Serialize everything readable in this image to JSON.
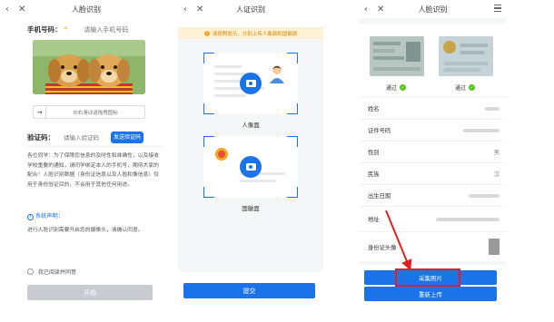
{
  "panel1": {
    "nav": {
      "back": "‹",
      "close": "✕",
      "title": "人脸识别"
    },
    "phone": {
      "label": "手机号码：",
      "required": "*",
      "placeholder": "请输入手机号码"
    },
    "doc_button": {
      "label": "向右滑动请拖拽图标"
    },
    "code": {
      "label": "验证码：",
      "placeholder": "请输入验证码",
      "send_button": "发送验证码"
    },
    "notice": "各位同学：为了保障您信息的及时性和准确性，以及接收学校重要的通知，请同学绑定本人的手机号，期待大家的配合！人脸识别数据（身份证信息以及人脸和像信息）仅用于身份验证目的，不会用于其他任何用途。",
    "declaration": {
      "title": "系统声明：",
      "text": "进行人脸识别需要开启您的摄像头，请确认同意。"
    },
    "agree": {
      "label": "我已阅读并同意"
    },
    "start_button": {
      "label": "开始"
    }
  },
  "panel2": {
    "nav": {
      "back": "‹",
      "close": "✕",
      "title": "人证识别"
    },
    "tip": {
      "icon": "!",
      "text": "请按照提示，分别上传人像面和国徽面"
    },
    "portrait_label": "人像面",
    "emblem_label": "国徽面",
    "submit_button": {
      "label": "提交"
    }
  },
  "panel3": {
    "nav": {
      "back": "‹",
      "close": "✕",
      "title": "人脸识别"
    },
    "front_status": "通过",
    "back_status": "通过",
    "fields": [
      {
        "label": "姓名"
      },
      {
        "label": "证件号码"
      },
      {
        "label": "性别",
        "value": "男"
      },
      {
        "label": "民族",
        "value": "汉"
      },
      {
        "label": "出生日期"
      },
      {
        "label": "地址"
      },
      {
        "label": "身份证头像"
      }
    ],
    "capture_button": {
      "label": "采集照片"
    },
    "reupload_button": {
      "label": "重新上传"
    }
  },
  "colors": {
    "accent": "#1a73e8",
    "highlight": "#e02020",
    "success": "#52c41a",
    "warning": "#f5a623"
  }
}
